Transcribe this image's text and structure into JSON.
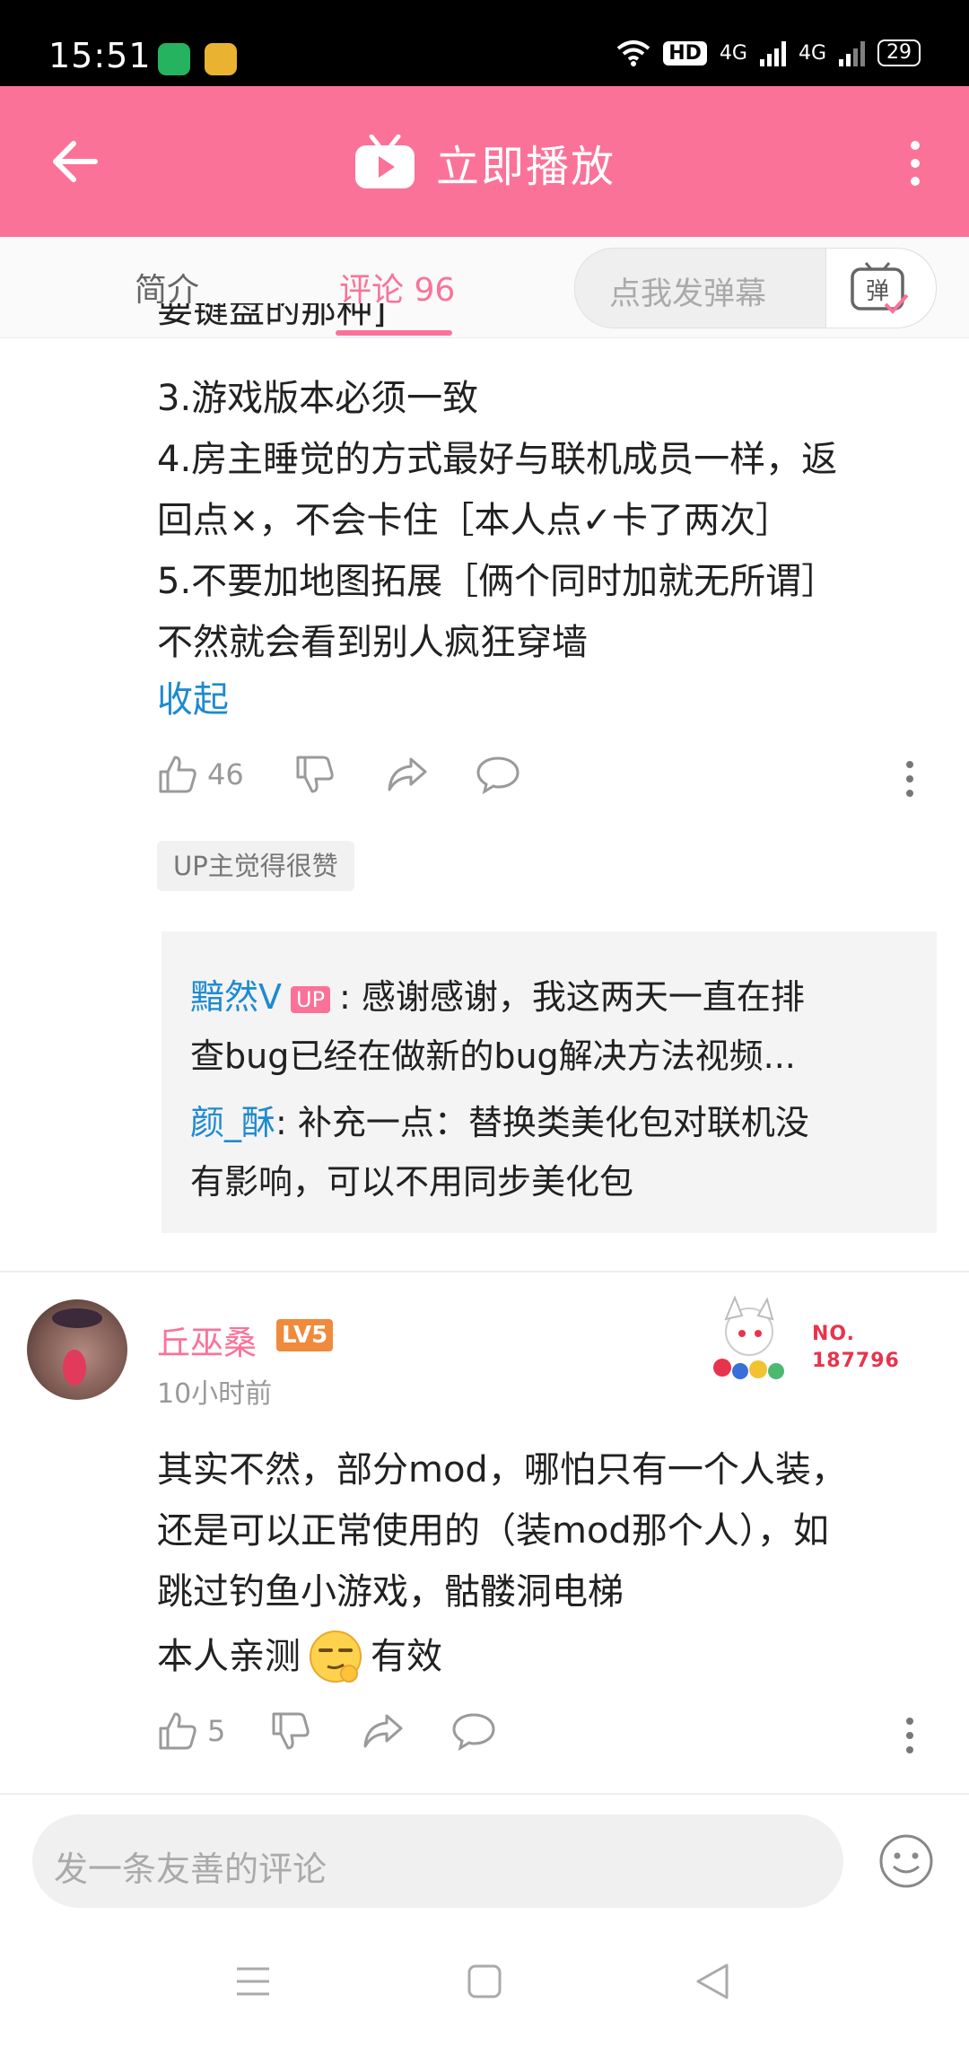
{
  "status_bar": {
    "time": "15:51",
    "hd_label": "HD",
    "network_1": "4G",
    "network_2": "4G",
    "battery": "29"
  },
  "header": {
    "title": "立即播放"
  },
  "tabs": {
    "intro": "简介",
    "comments": "评论 96",
    "danmaku_placeholder": "点我发弹幕",
    "danmaku_button": "弹"
  },
  "comment1": {
    "line0": "要键盘的那种]",
    "line1": "3.游戏版本必须一致",
    "line2": "4.房主睡觉的方式最好与联机成员一样，返",
    "line3": "回点×，不会卡住［本人点✓卡了两次］",
    "line4": "5.不要加地图拓展［俩个同时加就无所谓］",
    "line5": "不然就会看到别人疯狂穿墙",
    "collapse": "收起",
    "likes": "46",
    "up_tag": "UP主觉得很赞",
    "replies": {
      "r1_user": "黯然V",
      "r1_badge": "UP",
      "r1_text1": ": 感谢感谢，我这两天一直在排",
      "r1_text2": "查bug已经在做新的bug解决方法视频...",
      "r2_user": "颜_酥",
      "r2_text1": ": 补充一点：替换类美化包对联机没",
      "r2_text2": "有影响，可以不用同步美化包"
    }
  },
  "comment2": {
    "username": "丘巫桑",
    "level": "LV5",
    "time": "10小时前",
    "fan_no_label": "NO.",
    "fan_no_value": "187796",
    "line1": "其实不然，部分mod，哪怕只有一个人装，",
    "line2": "还是可以正常使用的（装mod那个人），如",
    "line3": "跳过钓鱼小游戏，骷髅洞电梯",
    "line4_before": "本人亲测",
    "line4_after": "有效",
    "likes": "5"
  },
  "composer": {
    "placeholder": "发一条友善的评论"
  },
  "colors": {
    "brand_pink": "#fb7299",
    "link_blue": "#1e8ad0",
    "level_orange": "#f08a3c"
  }
}
